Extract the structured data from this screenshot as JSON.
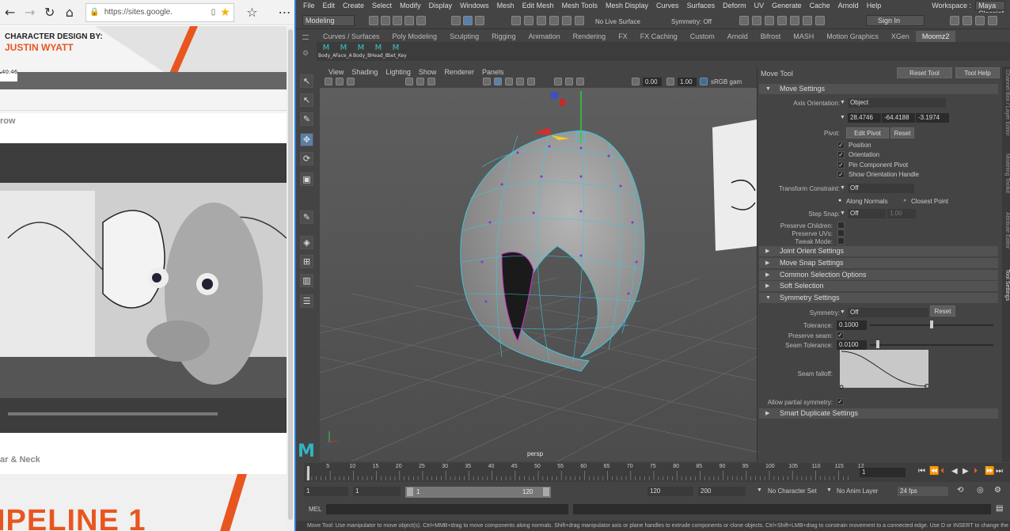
{
  "browser": {
    "url": "https://sites.google.",
    "page": {
      "heading_line1": "CHARACTER DESIGN BY:",
      "heading_line2": "JUSTIN WYATT",
      "video_time": "40:46",
      "section_partial": "row",
      "section_lower": "ar & Neck",
      "banner_partial": "IPELINE 1"
    }
  },
  "maya": {
    "menu": [
      "File",
      "Edit",
      "Create",
      "Select",
      "Modify",
      "Display",
      "Windows",
      "Mesh",
      "Edit Mesh",
      "Mesh Tools",
      "Mesh Display",
      "Curves",
      "Surfaces",
      "Deform",
      "UV",
      "Generate",
      "Cache",
      "Arnold",
      "Help"
    ],
    "workspace_label": "Workspace :",
    "workspace_value": "Maya Classic*",
    "mode_menu": "Modeling",
    "no_live_surface": "No Live Surface",
    "symmetry_status": "Symmetry: Off",
    "sign_in": "Sign In",
    "shelf_tabs": [
      "Curves / Surfaces",
      "Poly Modeling",
      "Sculpting",
      "Rigging",
      "Animation",
      "Rendering",
      "FX",
      "FX Caching",
      "Custom",
      "Arnold",
      "Bifrost",
      "MASH",
      "Motion Graphics",
      "XGen",
      "Moomz2"
    ],
    "shelf_buttons": [
      "Body_A",
      "Face_A",
      "Body_B",
      "Head_B",
      "Set_Key"
    ],
    "viewport_menu": [
      "View",
      "Shading",
      "Lighting",
      "Show",
      "Renderer",
      "Panels"
    ],
    "viewport_fields": {
      "exposure": "0.00",
      "gamma": "1.00",
      "colorspace": "sRGB gam"
    },
    "camera_label": "persp",
    "tool": {
      "title": "Move Tool",
      "reset_tool": "Reset Tool",
      "tool_help": "Tool Help",
      "sections": {
        "move": "Move Settings",
        "joint": "Joint Orient Settings",
        "snap": "Move Snap Settings",
        "common": "Common Selection Options",
        "soft": "Soft Selection",
        "symmetry": "Symmetry Settings",
        "smart": "Smart Duplicate Settings"
      },
      "axis_orientation_label": "Axis Orientation:",
      "axis_orientation_value": "Object",
      "axis_values": [
        "28.4746",
        "-64.4188",
        "-3.1974"
      ],
      "pivot_label": "Pivot:",
      "edit_pivot": "Edit Pivot",
      "reset": "Reset",
      "checks": [
        "Position",
        "Orientation",
        "Pin Component Pivot",
        "Show Orientation Handle"
      ],
      "transform_constraint_label": "Transform Constraint:",
      "transform_constraint_value": "Off",
      "along_normals": "Along Normals",
      "closest_point": "Closest Point",
      "step_snap_label": "Step Snap:",
      "step_snap_value": "Off",
      "step_snap_amount": "1.00",
      "preserve_children": "Preserve Children:",
      "preserve_uvs": "Preserve UVs:",
      "tweak_mode": "Tweak Mode:",
      "symmetry_label": "Symmetry:",
      "symmetry_value": "Off",
      "tolerance_label": "Tolerance:",
      "tolerance_value": "0.1000",
      "preserve_seam_label": "Preserve seam:",
      "seam_tolerance_label": "Seam Tolerance:",
      "seam_tolerance_value": "0.0100",
      "seam_falloff_label": "Seam falloff:",
      "allow_partial_label": "Allow partial symmetry:"
    },
    "right_tabs": [
      "Channel Box / Layer Editor",
      "Modeling Toolkit",
      "Attribute Editor",
      "Tool Settings"
    ],
    "timeline": {
      "ticks": [
        "5",
        "10",
        "15",
        "20",
        "25",
        "30",
        "35",
        "40",
        "45",
        "50",
        "55",
        "60",
        "65",
        "70",
        "75",
        "80",
        "85",
        "90",
        "95",
        "100",
        "105",
        "110",
        "115",
        "12"
      ],
      "current_frame": "1"
    },
    "range": {
      "start": "1",
      "playback_start": "1",
      "slider_start": "1",
      "slider_end": "120",
      "playback_end": "120",
      "end": "200",
      "character_set": "No Character Set",
      "anim_layer": "No Anim Layer",
      "fps": "24 fps"
    },
    "mel_label": "MEL",
    "help_text": "Move Tool: Use manipulator to move object(s). Ctrl+MMB+drag to move components along normals. Shift+drag manipulator axis or plane handles to extrude components or clone objects. Ctrl+Shift+LMB+drag to constrain movement to a connected edge. Use D or INSERT to change the pivot positio"
  }
}
